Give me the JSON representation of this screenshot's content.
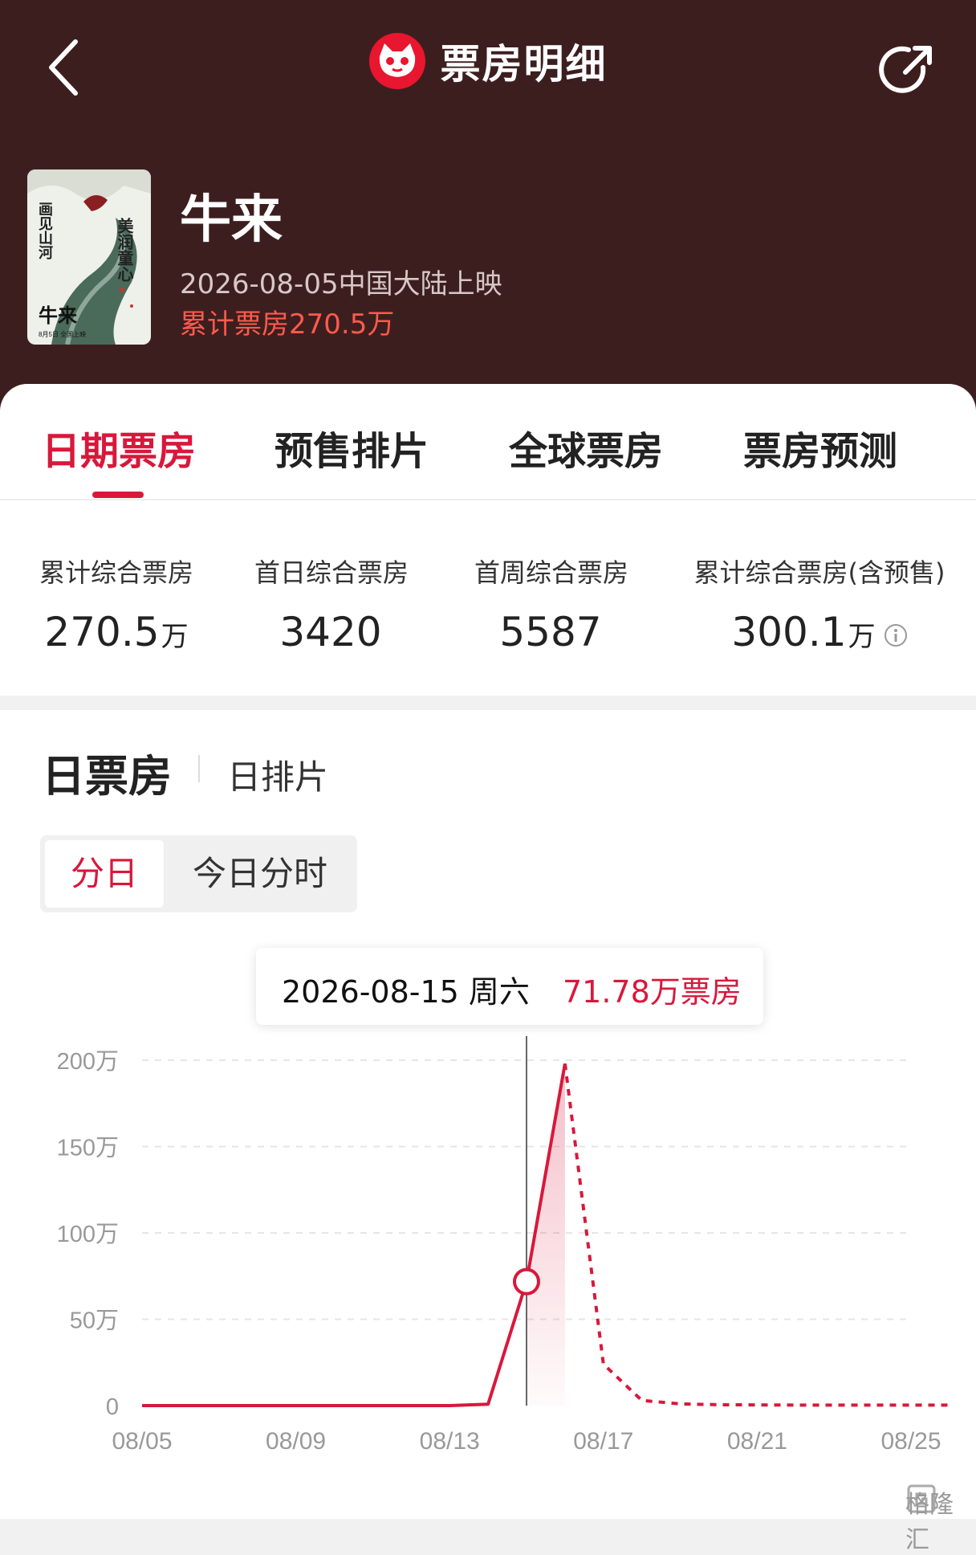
{
  "nav": {
    "title": "票房明细"
  },
  "movie": {
    "title": "牛来",
    "release": "2026-08-05中国大陆上映",
    "total": "累计票房270.5万",
    "poster_texts": [
      "美润童心",
      "画见山河",
      "牛来",
      "8月5日 全国上映"
    ]
  },
  "tabs": [
    "日期票房",
    "预售排片",
    "全球票房",
    "票房预测"
  ],
  "stats": [
    {
      "label": "累计综合票房",
      "value": "270.5",
      "unit": "万"
    },
    {
      "label": "首日综合票房",
      "value": "3420",
      "unit": ""
    },
    {
      "label": "首周综合票房",
      "value": "5587",
      "unit": ""
    },
    {
      "label": "累计综合票房(含预售)",
      "value": "300.1",
      "unit": "万"
    }
  ],
  "section": {
    "title": "日票房",
    "sub": "日排片"
  },
  "toggle": {
    "day": "分日",
    "hour": "今日分时"
  },
  "tooltip": {
    "date": "2026-08-15 周六",
    "value": "71.78万票房"
  },
  "colors": {
    "header_bg": "#3d1e1e",
    "accent": "#d8183b",
    "total_red": "#ff5a4d"
  },
  "icons": {
    "back": "chevron-left-icon",
    "logo": "cat-logo-icon",
    "share": "share-icon",
    "info": "info-icon"
  },
  "watermark": "格隆汇",
  "chart_data": {
    "type": "line",
    "x_ticks": [
      "08/05",
      "08/09",
      "08/13",
      "08/17",
      "08/21",
      "08/25"
    ],
    "y_ticks": [
      "0",
      "50万",
      "100万",
      "150万",
      "200万"
    ],
    "ylim": [
      0,
      200
    ],
    "grid": true,
    "series": [
      {
        "style": "solid",
        "x": [
          "08/05",
          "08/06",
          "08/07",
          "08/08",
          "08/09",
          "08/10",
          "08/11",
          "08/12",
          "08/13",
          "08/14",
          "08/15",
          "08/16"
        ],
        "values": [
          0,
          0,
          0,
          0,
          0,
          0,
          0,
          0,
          0,
          0.8,
          71.78,
          198
        ]
      },
      {
        "style": "dashed",
        "x": [
          "08/16",
          "08/17",
          "08/18",
          "08/19",
          "08/20",
          "08/21",
          "08/22",
          "08/23",
          "08/24",
          "08/25",
          "08/26"
        ],
        "values": [
          198,
          24,
          3,
          1,
          0.5,
          0.4,
          0.3,
          0.3,
          0.3,
          0.3,
          0.3
        ]
      }
    ],
    "highlight": {
      "x": "08/15",
      "value": 71.78
    }
  }
}
